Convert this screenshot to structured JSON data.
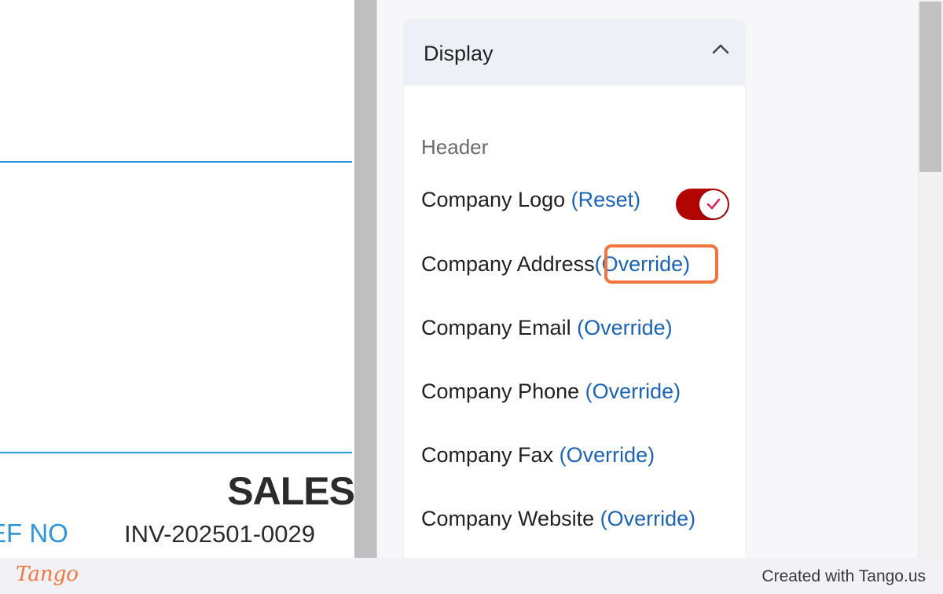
{
  "preview": {
    "document_title": "SALES",
    "ref_label": "EF NO",
    "ref_value": "INV-202501-0029"
  },
  "panel": {
    "section_title": "Display",
    "group_label": "Header",
    "rows": [
      {
        "label": "Company Logo",
        "action": "(Reset)",
        "toggle_on": true
      },
      {
        "label": "Company Address",
        "action": "(Override)"
      },
      {
        "label": "Company Email",
        "action": "(Override)"
      },
      {
        "label": "Company Phone",
        "action": "(Override)"
      },
      {
        "label": "Company Fax",
        "action": "(Override)"
      },
      {
        "label": "Company Website",
        "action": "(Override)"
      }
    ]
  },
  "footer": {
    "brand": "Tango",
    "credit": "Created with Tango.us"
  },
  "colors": {
    "accent_blue": "#2d95dc",
    "link_blue": "#1a63b8",
    "toggle_red": "#b30404",
    "highlight_orange": "#f3763f"
  }
}
